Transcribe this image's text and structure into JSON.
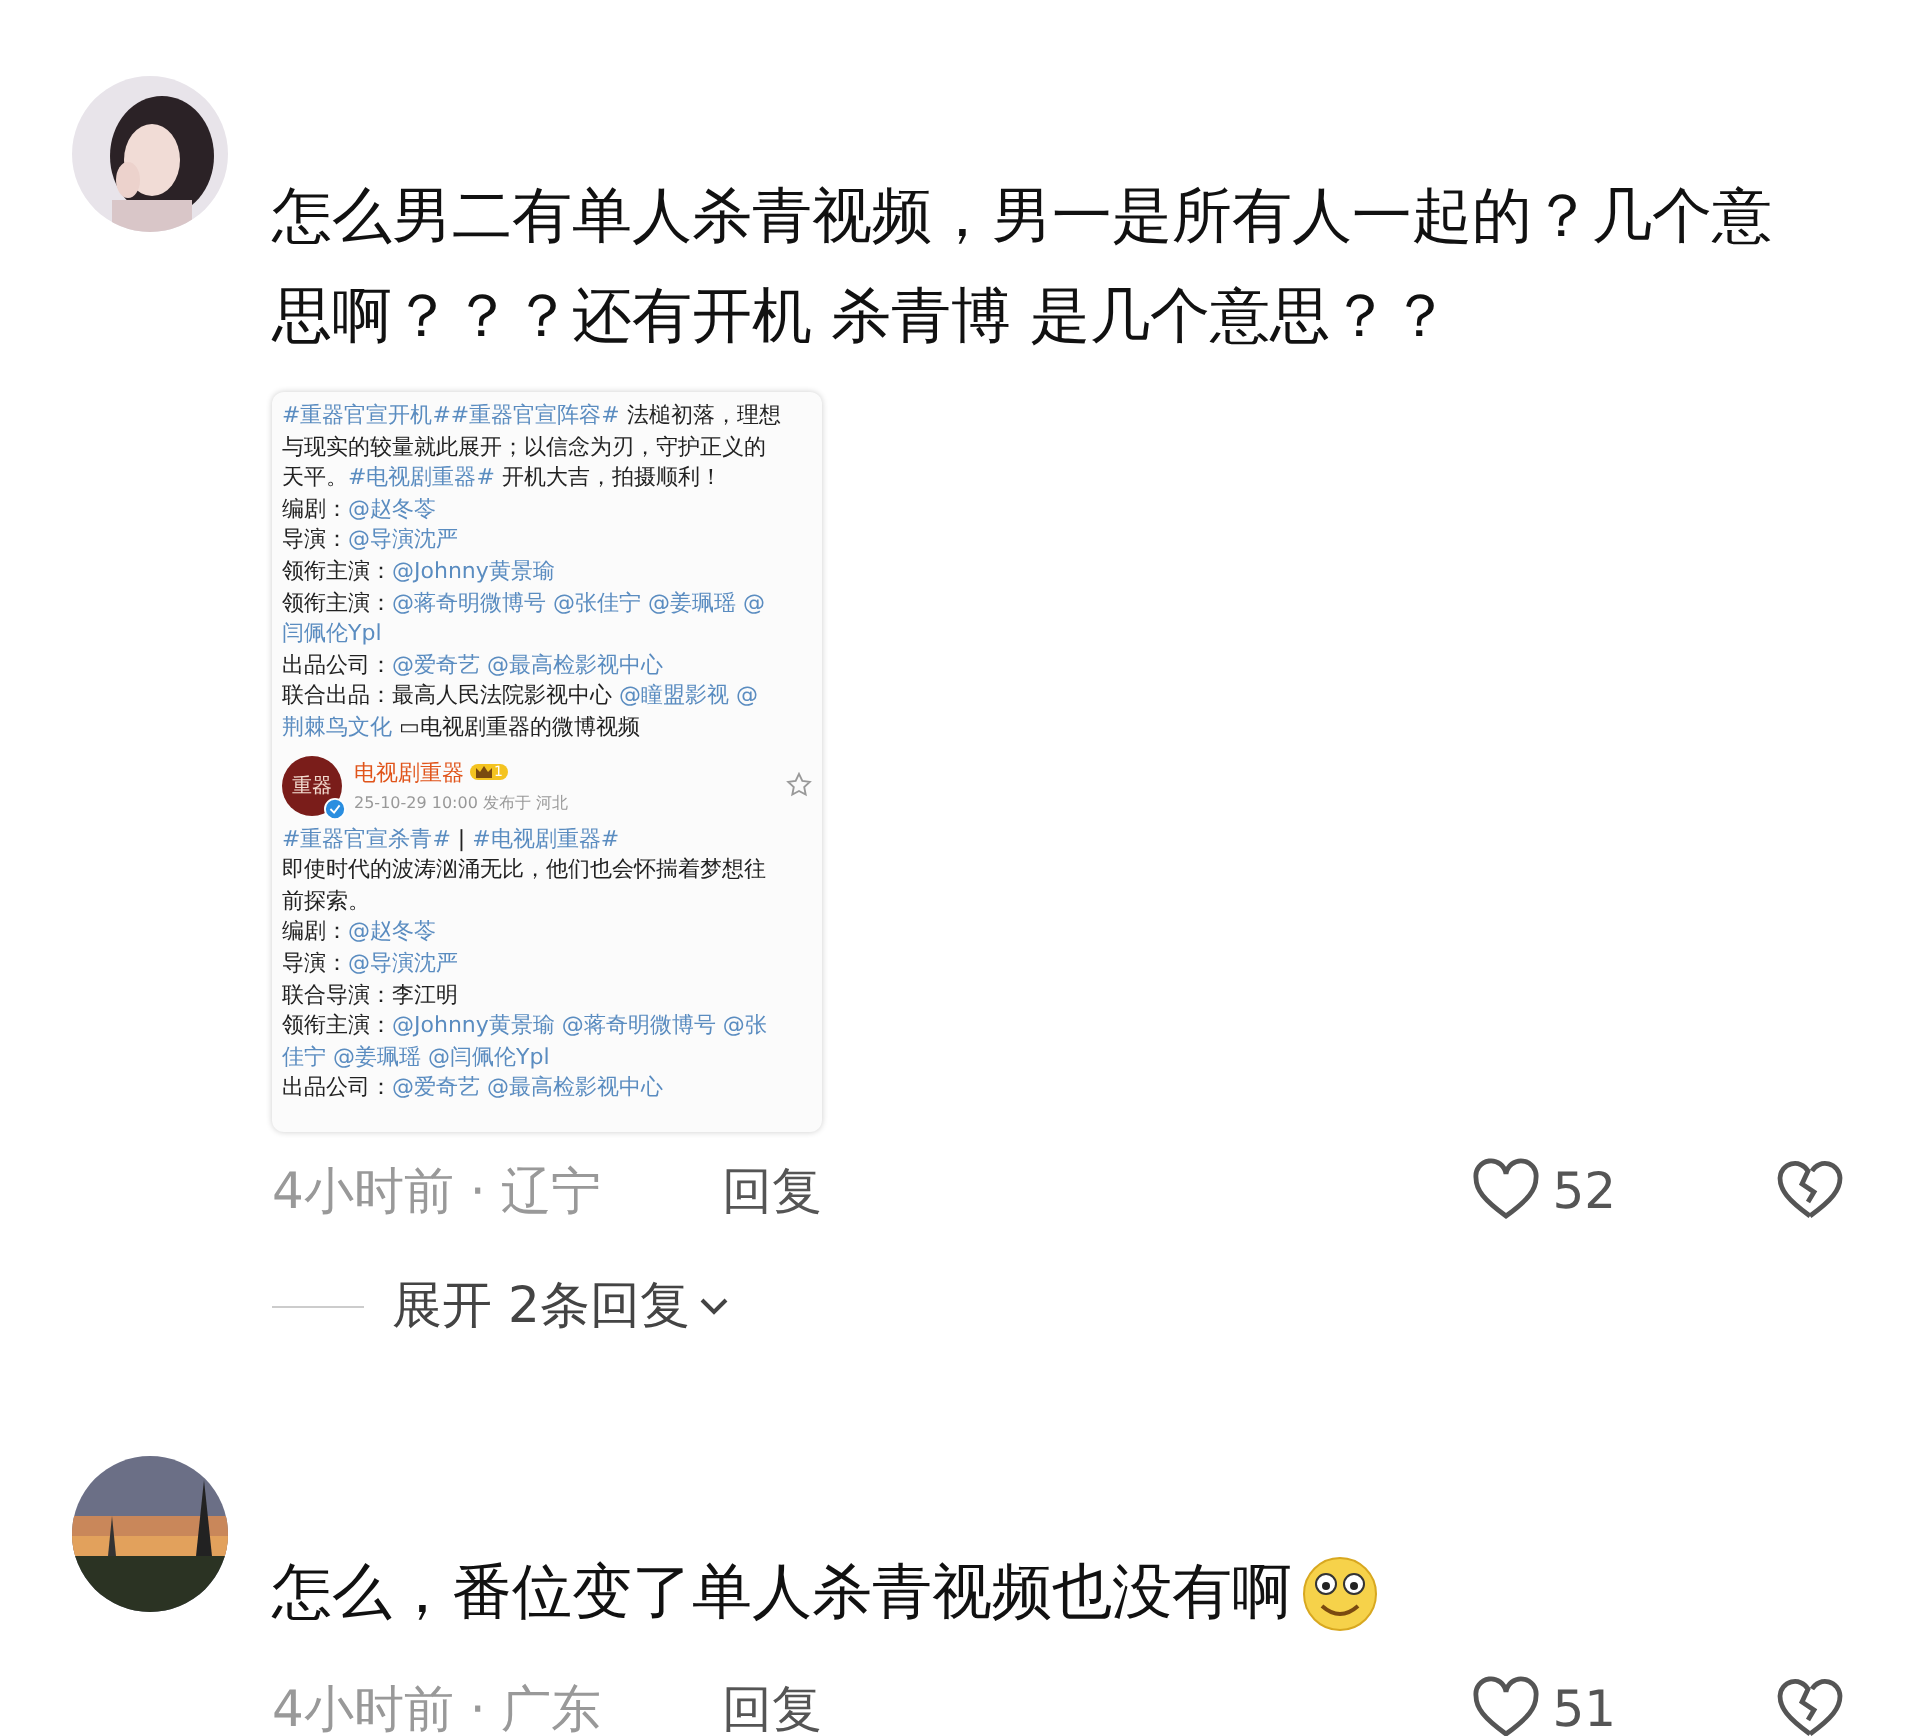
{
  "comments": [
    {
      "text": "怎么男二有单人杀青视频，男一是所有人一起的？几个意思啊？？？还有开机 杀青博 是几个意思？？",
      "embed": {
        "top_lines": [
          [
            {
              "kind": "link",
              "text": "#重器官宣开机##重器官宣阵容#"
            },
            {
              "kind": "plain",
              "text": " 法槌初落，理想"
            }
          ],
          [
            {
              "kind": "plain",
              "text": "与现实的较量就此展开；以信念为刃，守护正义的"
            }
          ],
          [
            {
              "kind": "plain",
              "text": "天平。"
            },
            {
              "kind": "link",
              "text": "#电视剧重器#"
            },
            {
              "kind": "plain",
              "text": " 开机大吉，拍摄顺利！"
            }
          ],
          [
            {
              "kind": "plain",
              "text": "编剧："
            },
            {
              "kind": "link",
              "text": "@赵冬苓"
            }
          ],
          [
            {
              "kind": "plain",
              "text": "导演："
            },
            {
              "kind": "link",
              "text": "@导演沈严"
            }
          ],
          [
            {
              "kind": "plain",
              "text": "领衔主演："
            },
            {
              "kind": "link",
              "text": "@Johnny黄景瑜"
            }
          ],
          [
            {
              "kind": "plain",
              "text": "领衔主演："
            },
            {
              "kind": "link",
              "text": "@蒋奇明微博号 @张佳宁 @姜珮瑶 @"
            }
          ],
          [
            {
              "kind": "link",
              "text": "闫佩伦Ypl"
            }
          ],
          [
            {
              "kind": "plain",
              "text": "出品公司："
            },
            {
              "kind": "link",
              "text": "@爱奇艺 @最高检影视中心"
            }
          ],
          [
            {
              "kind": "plain",
              "text": "联合出品：最高人民法院影视中心 "
            },
            {
              "kind": "link",
              "text": "@瞳盟影视 @"
            }
          ],
          [
            {
              "kind": "link",
              "text": "荆棘鸟文化 "
            },
            {
              "kind": "plain",
              "text": "▭电视剧重器的微博视频"
            }
          ]
        ],
        "author": {
          "logo": "重器",
          "name": "电视剧重器",
          "level": "1",
          "meta": "25-10-29 10:00  发布于 河北"
        },
        "bottom_lines": [
          [
            {
              "kind": "link",
              "text": "#重器官宣杀青#"
            },
            {
              "kind": "plain",
              "text": " | "
            },
            {
              "kind": "link",
              "text": "#电视剧重器#"
            }
          ],
          [
            {
              "kind": "plain",
              "text": "即使时代的波涛汹涌无比，他们也会怀揣着梦想往"
            }
          ],
          [
            {
              "kind": "plain",
              "text": "前探索。"
            }
          ],
          [
            {
              "kind": "plain",
              "text": "编剧："
            },
            {
              "kind": "link",
              "text": "@赵冬苓"
            }
          ],
          [
            {
              "kind": "plain",
              "text": "导演："
            },
            {
              "kind": "link",
              "text": "@导演沈严"
            }
          ],
          [
            {
              "kind": "plain",
              "text": "联合导演：李江明"
            }
          ],
          [
            {
              "kind": "plain",
              "text": "领衔主演："
            },
            {
              "kind": "link",
              "text": "@Johnny黄景瑜 @蒋奇明微博号 @张"
            }
          ],
          [
            {
              "kind": "link",
              "text": "佳宁 @姜珮瑶 @闫佩伦Ypl"
            }
          ],
          [
            {
              "kind": "plain",
              "text": "出品公司："
            },
            {
              "kind": "link",
              "text": "@爱奇艺 @最高检影视中心"
            }
          ]
        ]
      },
      "time": "4小时前 · 辽宁",
      "reply": "回复",
      "likes": "52",
      "expand": "展开 2条回复"
    },
    {
      "text": "怎么，番位变了单人杀青视频也没有啊",
      "emoji": true,
      "time": "4小时前 · 广东",
      "reply": "回复",
      "likes": "51"
    }
  ]
}
